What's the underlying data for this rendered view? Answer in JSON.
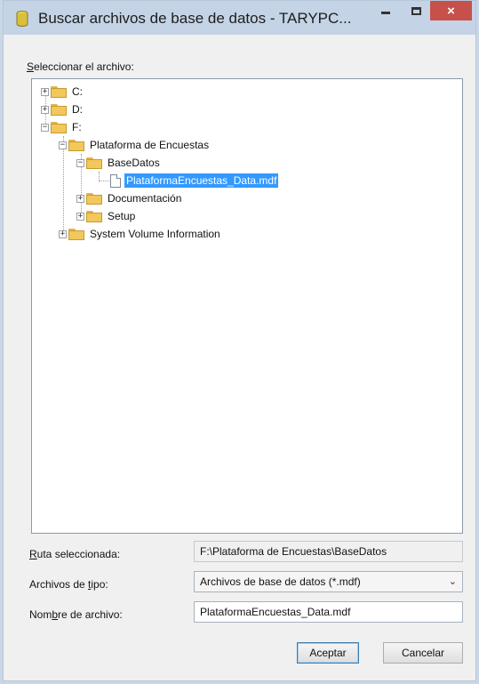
{
  "window": {
    "title": "Buscar archivos de base de datos - TARYPC...",
    "close_glyph": "×"
  },
  "tree": {
    "label_prefix": "S",
    "label_rest": "eleccionar el archivo:",
    "nodes": [
      {
        "label": "C:",
        "type": "drive",
        "expanded": false
      },
      {
        "label": "D:",
        "type": "drive",
        "expanded": false
      },
      {
        "label": "F:",
        "type": "drive",
        "expanded": true
      },
      {
        "label": "Plataforma de Encuestas",
        "type": "folder",
        "expanded": true
      },
      {
        "label": "BaseDatos",
        "type": "folder",
        "expanded": true
      },
      {
        "label": "PlataformaEncuestas_Data.mdf",
        "type": "file",
        "selected": true
      },
      {
        "label": "Documentación",
        "type": "folder",
        "expanded": false
      },
      {
        "label": "Setup",
        "type": "folder",
        "expanded": false
      },
      {
        "label": "System Volume Information",
        "type": "folder",
        "expanded": false
      }
    ]
  },
  "fields": {
    "path_label_u": "R",
    "path_label_rest": "uta seleccionada:",
    "path_value": "F:\\Plataforma de Encuestas\\BaseDatos",
    "type_label_pre": "Archivos de ",
    "type_label_u": "t",
    "type_label_post": "ipo:",
    "type_value": "Archivos de base de datos (*.mdf)",
    "name_label_pre": "Nom",
    "name_label_u": "b",
    "name_label_post": "re de archivo:",
    "name_value": "PlataformaEncuestas_Data.mdf"
  },
  "buttons": {
    "accept": "Aceptar",
    "cancel": "Cancelar"
  },
  "icons": {
    "plus": "+",
    "minus": "−",
    "dropdown": "⌄"
  },
  "colors": {
    "selection": "#3399ff",
    "close": "#c7504a",
    "titlebar": "#c4d3e6"
  }
}
